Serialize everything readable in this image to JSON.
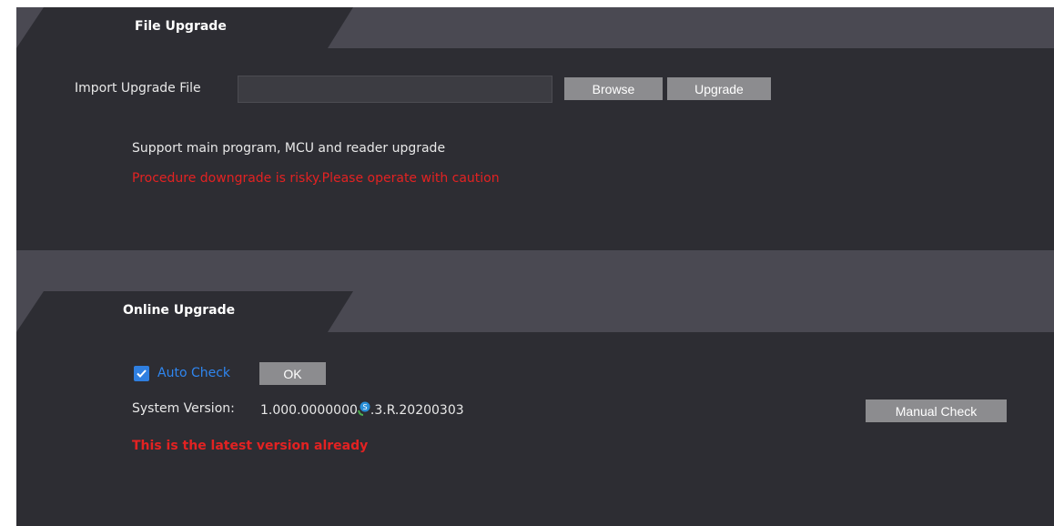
{
  "file_upgrade": {
    "title": "File Upgrade",
    "import_label": "Import Upgrade File",
    "file_value": "",
    "browse_label": "Browse",
    "upgrade_label": "Upgrade",
    "support_text": "Support main program, MCU and reader upgrade",
    "warning_text": "Procedure downgrade is risky.Please operate with caution"
  },
  "online_upgrade": {
    "title": "Online Upgrade",
    "auto_check_label": "Auto Check",
    "auto_check_checked": true,
    "ok_label": "OK",
    "system_version_label": "System Version:",
    "system_version_value_prefix": "1.000.0000000",
    "system_version_value_suffix": ".3.R.20200303",
    "manual_check_label": "Manual Check",
    "status_text": "This is the latest version already"
  },
  "colors": {
    "panel_bg": "#2d2d33",
    "header_bg": "#4a4952",
    "button_bg": "#8c8c8f",
    "warning": "#e32222",
    "checkbox_accent": "#2f7fe0"
  }
}
